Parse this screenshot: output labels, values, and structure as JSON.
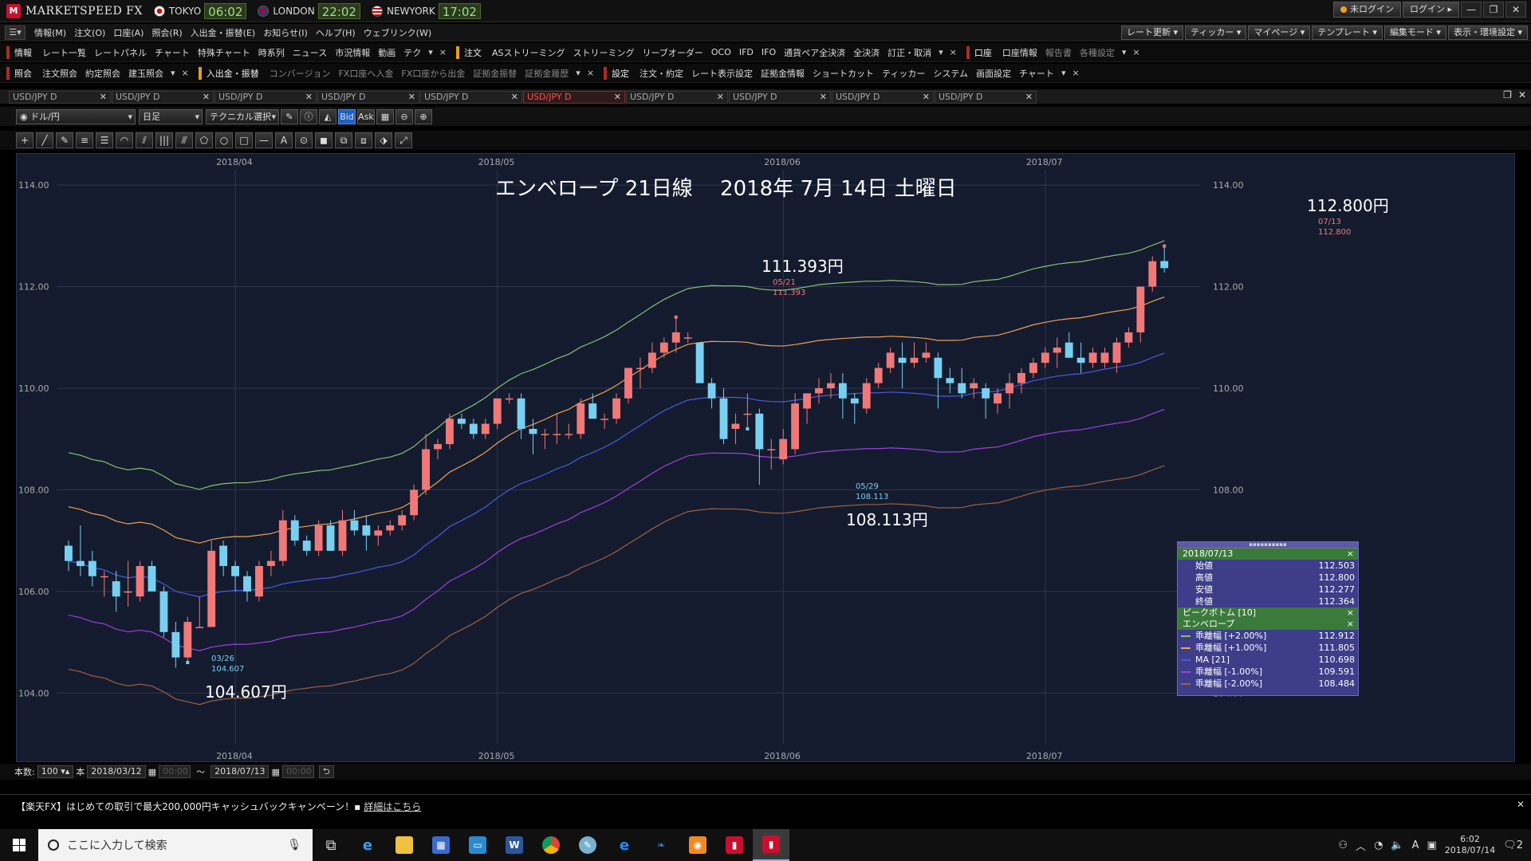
{
  "titlebar": {
    "app_title": "MARKETSPEED FX",
    "clocks": [
      {
        "city": "TOKYO",
        "time": "06:02"
      },
      {
        "city": "LONDON",
        "time": "22:02"
      },
      {
        "city": "NEWYORK",
        "time": "17:02"
      }
    ],
    "login_status": "未ログイン",
    "login_button": "ログイン",
    "win_min": "—",
    "win_max": "❐",
    "win_close": "✕"
  },
  "menubar": {
    "items": [
      "情報(M)",
      "注文(O)",
      "口座(A)",
      "照会(R)",
      "入出金・振替(E)",
      "お知らせ(I)",
      "ヘルプ(H)",
      "ウェブリンク(W)"
    ],
    "right_buttons": [
      "レート更新 ▾",
      "ティッカー ▾",
      "マイページ ▾",
      "テンプレート ▾",
      "編集モード ▾",
      "表示・環境設定 ▾"
    ]
  },
  "toolrow1": {
    "group1_label": "情報",
    "group1_items": [
      "レート一覧",
      "レートパネル",
      "チャート",
      "特殊チャート",
      "時系列",
      "ニュース",
      "市況情報",
      "動画",
      "テク"
    ],
    "group2_label": "注文",
    "group2_items": [
      "ASストリーミング",
      "ストリーミング",
      "リーブオーダー",
      "OCO",
      "IFD",
      "IFO",
      "通貨ペア全決済",
      "全決済",
      "訂正・取消"
    ],
    "group3_label": "口座",
    "group3_items": [
      "口座情報",
      "報告書",
      "各種設定"
    ]
  },
  "toolrow2": {
    "group1_label": "照会",
    "group1_items": [
      "注文照会",
      "約定照会",
      "建玉照会"
    ],
    "group2_label": "入出金・振替",
    "group2_items": [
      "コンバージョン",
      "FX口座へ入金",
      "FX口座から出金",
      "証拠金振替",
      "証拠金履歴"
    ],
    "group3_label": "設定",
    "group3_items": [
      "注文・約定",
      "レート表示設定",
      "証拠金情報",
      "ショートカット",
      "ティッカー",
      "システム",
      "画面設定",
      "チャート"
    ]
  },
  "tabs": [
    "USD/JPY D",
    "USD/JPY D",
    "USD/JPY D",
    "USD/JPY D",
    "USD/JPY D",
    "USD/JPY D",
    "USD/JPY D",
    "USD/JPY D",
    "USD/JPY D",
    "USD/JPY D"
  ],
  "active_tab_index": 5,
  "charttool": {
    "pair": "ドル/円",
    "period": "日足",
    "technical": "テクニカル選択",
    "bid": "Bid",
    "ask": "Ask"
  },
  "drawtools": [
    "+",
    "╱",
    "✎",
    "≡",
    "☰",
    "◠",
    "⫽",
    "|||",
    "⫻",
    "⬠",
    "○",
    "□",
    "—",
    "A",
    "⊙",
    "◼",
    "⧉",
    "⧈",
    "⬗",
    "⤢"
  ],
  "chart": {
    "title": "エンベロープ 21日線　 2018年 7月 14日 土曜日",
    "annotations": [
      {
        "label": "112.800円",
        "date": "07/13",
        "value": "112.800"
      },
      {
        "label": "111.393円",
        "date": "05/21",
        "value": "111.393"
      },
      {
        "label": "108.113円",
        "date": "05/29",
        "value": "108.113"
      },
      {
        "label": "104.607円",
        "date": "03/26",
        "value": "104.607"
      }
    ],
    "month_labels": [
      "2018/04",
      "2018/05",
      "2018/06",
      "2018/07"
    ]
  },
  "chart_data": {
    "type": "candlestick",
    "title": "エンベロープ 21日線　 2018年 7月 14日 土曜日",
    "ylim": [
      103.0,
      114.3
    ],
    "yticks": [
      "104.00",
      "106.00",
      "108.00",
      "110.00",
      "112.00",
      "114.00"
    ],
    "x_month_ticks": [
      {
        "label": "2018/04",
        "index": 14
      },
      {
        "label": "2018/05",
        "index": 36
      },
      {
        "label": "2018/06",
        "index": 60
      },
      {
        "label": "2018/07",
        "index": 82
      }
    ],
    "colors": {
      "up": "#f07878",
      "down": "#78d0f0",
      "p2": "#8ac070",
      "p1": "#f0a050",
      "ma": "#4a5ae0",
      "m1": "#a040e0",
      "m2": "#a06040"
    },
    "ohlc": [
      [
        106.9,
        107.0,
        106.4,
        106.6
      ],
      [
        106.6,
        107.3,
        106.3,
        106.5
      ],
      [
        106.6,
        106.8,
        106.1,
        106.3
      ],
      [
        106.3,
        106.4,
        105.9,
        106.3
      ],
      [
        106.2,
        106.4,
        105.6,
        105.9
      ],
      [
        106.0,
        106.6,
        105.7,
        106.0
      ],
      [
        105.9,
        106.6,
        105.8,
        106.5
      ],
      [
        106.5,
        106.6,
        106.0,
        106.0
      ],
      [
        106.0,
        106.1,
        105.1,
        105.2
      ],
      [
        105.2,
        105.4,
        104.5,
        104.7
      ],
      [
        104.7,
        105.5,
        104.6,
        105.4
      ],
      [
        105.3,
        105.9,
        105.3,
        105.3
      ],
      [
        105.3,
        107.0,
        105.3,
        106.8
      ],
      [
        106.9,
        107.0,
        106.3,
        106.5
      ],
      [
        106.5,
        106.6,
        106.0,
        106.3
      ],
      [
        106.3,
        106.4,
        105.8,
        106.0
      ],
      [
        105.9,
        106.6,
        105.8,
        106.5
      ],
      [
        106.5,
        106.8,
        106.3,
        106.6
      ],
      [
        106.6,
        107.6,
        106.5,
        107.4
      ],
      [
        107.4,
        107.5,
        106.9,
        107.0
      ],
      [
        107.0,
        107.1,
        106.7,
        106.8
      ],
      [
        106.8,
        107.4,
        106.7,
        107.3
      ],
      [
        107.3,
        107.4,
        106.8,
        106.8
      ],
      [
        106.8,
        107.6,
        106.7,
        107.4
      ],
      [
        107.4,
        107.6,
        107.1,
        107.2
      ],
      [
        107.3,
        107.5,
        106.8,
        107.1
      ],
      [
        107.1,
        107.3,
        106.9,
        107.2
      ],
      [
        107.2,
        107.4,
        107.1,
        107.3
      ],
      [
        107.3,
        107.6,
        107.2,
        107.5
      ],
      [
        107.5,
        108.1,
        107.4,
        108.0
      ],
      [
        108.0,
        109.1,
        107.9,
        108.8
      ],
      [
        108.8,
        109.0,
        108.6,
        108.9
      ],
      [
        108.9,
        109.5,
        108.8,
        109.4
      ],
      [
        109.4,
        109.5,
        109.2,
        109.3
      ],
      [
        109.3,
        109.4,
        109.0,
        109.1
      ],
      [
        109.1,
        109.4,
        109.0,
        109.3
      ],
      [
        109.3,
        109.8,
        109.2,
        109.8
      ],
      [
        109.8,
        109.9,
        109.7,
        109.8
      ],
      [
        109.8,
        109.9,
        109.0,
        109.2
      ],
      [
        109.2,
        109.4,
        108.7,
        109.1
      ],
      [
        109.1,
        109.2,
        108.8,
        109.1
      ],
      [
        109.1,
        109.5,
        108.9,
        109.1
      ],
      [
        109.1,
        109.3,
        109.0,
        109.1
      ],
      [
        109.1,
        109.8,
        109.0,
        109.7
      ],
      [
        109.7,
        109.9,
        109.4,
        109.4
      ],
      [
        109.4,
        109.5,
        109.2,
        109.4
      ],
      [
        109.4,
        109.9,
        109.3,
        109.8
      ],
      [
        109.8,
        110.3,
        109.7,
        110.4
      ],
      [
        110.4,
        110.6,
        110.0,
        110.4
      ],
      [
        110.4,
        110.9,
        110.3,
        110.7
      ],
      [
        110.7,
        111.0,
        110.6,
        110.9
      ],
      [
        110.9,
        111.4,
        110.7,
        111.1
      ],
      [
        111.0,
        111.1,
        110.9,
        111.0
      ],
      [
        110.9,
        110.9,
        110.3,
        110.1
      ],
      [
        110.1,
        110.2,
        109.6,
        109.8
      ],
      [
        109.8,
        110.0,
        108.9,
        109.0
      ],
      [
        109.2,
        109.5,
        108.9,
        109.3
      ],
      [
        109.5,
        109.9,
        109.2,
        109.5
      ],
      [
        109.5,
        109.6,
        108.1,
        108.8
      ],
      [
        108.8,
        109.0,
        108.4,
        108.8
      ],
      [
        108.6,
        109.2,
        108.5,
        109.0
      ],
      [
        108.8,
        109.9,
        108.7,
        109.7
      ],
      [
        109.6,
        109.9,
        109.3,
        109.9
      ],
      [
        109.9,
        110.2,
        109.7,
        110.0
      ],
      [
        110.0,
        110.3,
        109.8,
        110.1
      ],
      [
        110.1,
        110.3,
        109.4,
        109.8
      ],
      [
        109.8,
        109.9,
        109.3,
        109.7
      ],
      [
        109.6,
        110.2,
        109.5,
        110.1
      ],
      [
        110.1,
        110.5,
        110.0,
        110.4
      ],
      [
        110.4,
        110.8,
        110.3,
        110.7
      ],
      [
        110.6,
        110.9,
        110.0,
        110.5
      ],
      [
        110.5,
        110.9,
        110.4,
        110.6
      ],
      [
        110.6,
        110.9,
        110.5,
        110.7
      ],
      [
        110.6,
        110.7,
        109.6,
        110.2
      ],
      [
        110.2,
        110.4,
        109.9,
        110.1
      ],
      [
        110.1,
        110.4,
        109.8,
        109.9
      ],
      [
        110.0,
        110.2,
        109.8,
        110.1
      ],
      [
        110.0,
        110.1,
        109.4,
        109.8
      ],
      [
        109.7,
        110.0,
        109.5,
        109.9
      ],
      [
        109.9,
        110.3,
        109.6,
        110.1
      ],
      [
        110.1,
        110.4,
        109.9,
        110.3
      ],
      [
        110.3,
        110.6,
        110.2,
        110.5
      ],
      [
        110.5,
        110.8,
        110.4,
        110.7
      ],
      [
        110.7,
        111.0,
        110.4,
        110.8
      ],
      [
        110.9,
        111.1,
        110.6,
        110.6
      ],
      [
        110.6,
        110.9,
        110.3,
        110.5
      ],
      [
        110.5,
        110.8,
        110.4,
        110.7
      ],
      [
        110.5,
        110.8,
        110.4,
        110.7
      ],
      [
        110.5,
        111.0,
        110.3,
        110.9
      ],
      [
        110.9,
        111.2,
        110.8,
        111.1
      ],
      [
        111.1,
        112.0,
        110.9,
        112.0
      ],
      [
        112.0,
        112.6,
        111.9,
        112.5
      ],
      [
        112.503,
        112.8,
        112.277,
        112.364
      ]
    ],
    "envelope": {
      "ma21_last": 110.698,
      "p2_last": 112.912,
      "p1_last": 111.805,
      "m1_last": 109.591,
      "m2_last": 108.484
    }
  },
  "info_panel": {
    "date": "2018/07/13",
    "rows": [
      {
        "label": "始値",
        "value": "112.503"
      },
      {
        "label": "高値",
        "value": "112.800"
      },
      {
        "label": "安値",
        "value": "112.277"
      },
      {
        "label": "終値",
        "value": "112.364"
      }
    ],
    "peak_label": "ピークボトム [10]",
    "env_label": "エンベロープ",
    "env_rows": [
      {
        "label": "乖離幅 [+2.00%]",
        "value": "112.912",
        "color": "#8ac070"
      },
      {
        "label": "乖離幅 [+1.00%]",
        "value": "111.805",
        "color": "#f0a050"
      },
      {
        "label": "MA [21]",
        "value": "110.698",
        "color": "#4a5ae0"
      },
      {
        "label": "乖離幅 [-1.00%]",
        "value": "109.591",
        "color": "#a040e0"
      },
      {
        "label": "乖離幅 [-2.00%]",
        "value": "108.484",
        "color": "#a06040"
      }
    ]
  },
  "bottombar": {
    "count_label": "本数:",
    "count_value": "100",
    "unit": "本",
    "from_date": "2018/03/12",
    "from_time": "00:00",
    "tilde": "～",
    "to_date": "2018/07/13",
    "to_time": "00:00"
  },
  "campaign": {
    "text": "【楽天FX】はじめての取引で最大200,000円キャッシュバックキャンペーン！",
    "link": "詳細はこちら"
  },
  "taskbar": {
    "search_placeholder": "ここに入力して検索",
    "tray_time": "6:02",
    "tray_date": "2018/07/14",
    "ime": "A",
    "notif": "2"
  }
}
